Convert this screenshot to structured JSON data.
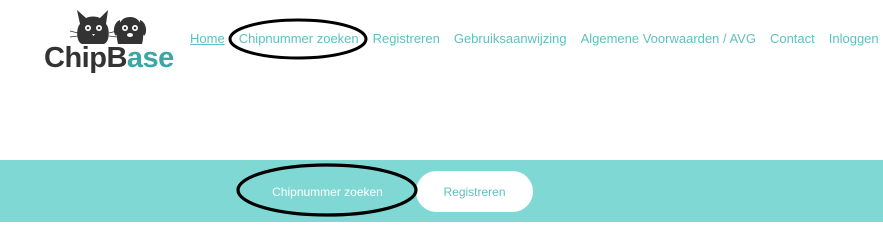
{
  "logo": {
    "text_chip": "Chip",
    "text_b": "B",
    "text_ase": "ase",
    "icon": "cat-dog-icon"
  },
  "nav": {
    "items": [
      {
        "label": "Home",
        "active": true
      },
      {
        "label": "Chipnummer zoeken",
        "active": false
      },
      {
        "label": "Registreren",
        "active": false
      },
      {
        "label": "Gebruiksaanwijzing",
        "active": false
      },
      {
        "label": "Algemene Voorwaarden / AVG",
        "active": false
      },
      {
        "label": "Contact",
        "active": false
      },
      {
        "label": "Inloggen",
        "active": false
      }
    ]
  },
  "band": {
    "search_button": "Chipnummer zoeken",
    "register_button": "Registreren"
  },
  "colors": {
    "accent": "#5cc2bf",
    "band": "#7fd8d4",
    "logo_dark": "#333333",
    "logo_teal": "#3aa7a3",
    "marker": "#000000"
  }
}
